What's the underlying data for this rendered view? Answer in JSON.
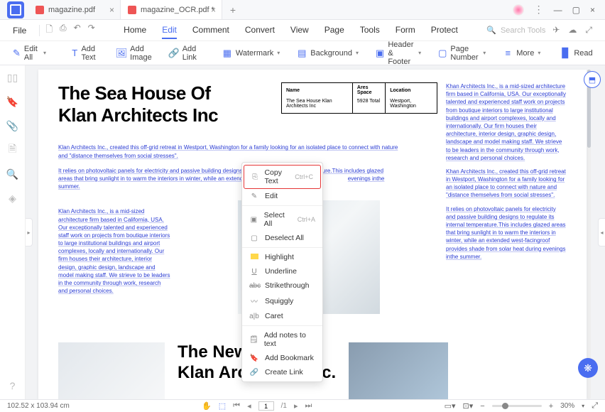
{
  "tabs": [
    {
      "label": "magazine.pdf"
    },
    {
      "label": "magazine_OCR.pdf *"
    }
  ],
  "menubar": {
    "file": "File",
    "items": [
      "Home",
      "Edit",
      "Comment",
      "Convert",
      "View",
      "Page",
      "Tools",
      "Form",
      "Protect"
    ],
    "search_placeholder": "Search Tools"
  },
  "toolbar": {
    "edit_all": "Edit All",
    "add_text": "Add Text",
    "add_image": "Add Image",
    "add_link": "Add Link",
    "watermark": "Watermark",
    "background": "Background",
    "header_footer": "Header & Footer",
    "page_number": "Page Number",
    "more": "More",
    "read": "Read"
  },
  "document": {
    "title_line1": "The  Sea House Of",
    "title_line2": "Klan Architects Inc",
    "table": {
      "headers": [
        "Name",
        "Ares Space",
        "Location"
      ],
      "cells": [
        "The Sea House Klan Architects Inc",
        "5928 Total",
        "Westport, Washington"
      ]
    },
    "para1": "Klan Architects Inc., created this off-grid retreat in Westport, Washington for a family looking for an isolated place to connect with nature and \"distance themselves from social stresses\".",
    "para2_a": "It relies on photovoltaic panels for electricity and passive building designs to regulate its internal temperature.This includes glazed areas that bring sunlight in to warm the interiors in winter, while an extended west-facingroof pro",
    "para2_b": "evenings inthe summer.",
    "left_col": "Klan Architects Inc., is a mid-sized architecture firm based in California, USA. Our exceptionally talented and experienced staff work on projects from boutique interiors to large institutional buildings and airport complexes, locally and internationally. Our firm houses their architecture, interior design, graphic design, landscape and model making staff. We strieve to be leaders in the community through work, research and personal choices.",
    "right_p1": "Khan Architects Inc., is a mid-sized architecture firm based in California, USA. Our exceptionally talented and experienced staff work on projects from boutique interiors to large institutional buildings and airport complexes, locally and internationally. Our firm houses their architecture, interior design, graphic design, landscape and model making staff. We strieve to be leaders in the community through work, research and personal choices.",
    "right_p2": "Khan Architects Inc., created this off-grid retreat in Westport, Washington for a family looking for an isolated place to connect with nature and \"distance themselves from social stresses\".",
    "right_p3": "It relies on photovoltaic panels for electricity and passive building designs to regulate its internal temperature.This includes glazed areas that bring sunlight in to warm the interiors in winter, while an extended west-facingroof provides shade from solar heat during evenings inthe summer.",
    "bottom_title1": "The New Work Of",
    "bottom_title2": "Klan Architects Inc."
  },
  "context_menu": {
    "copy_text": "Copy Text",
    "copy_sc": "Ctrl+C",
    "edit": "Edit",
    "select_all": "Select All",
    "select_sc": "Ctrl+A",
    "deselect": "Deselect All",
    "highlight": "Highlight",
    "underline": "Underline",
    "strikethrough": "Strikethrough",
    "squiggly": "Squiggly",
    "caret": "Caret",
    "add_notes": "Add notes to text",
    "add_bookmark": "Add Bookmark",
    "create_link": "Create Link"
  },
  "status": {
    "dims": "102.52 x 103.94 cm",
    "page_current": "1",
    "page_total": "/1",
    "zoom": "30%"
  }
}
